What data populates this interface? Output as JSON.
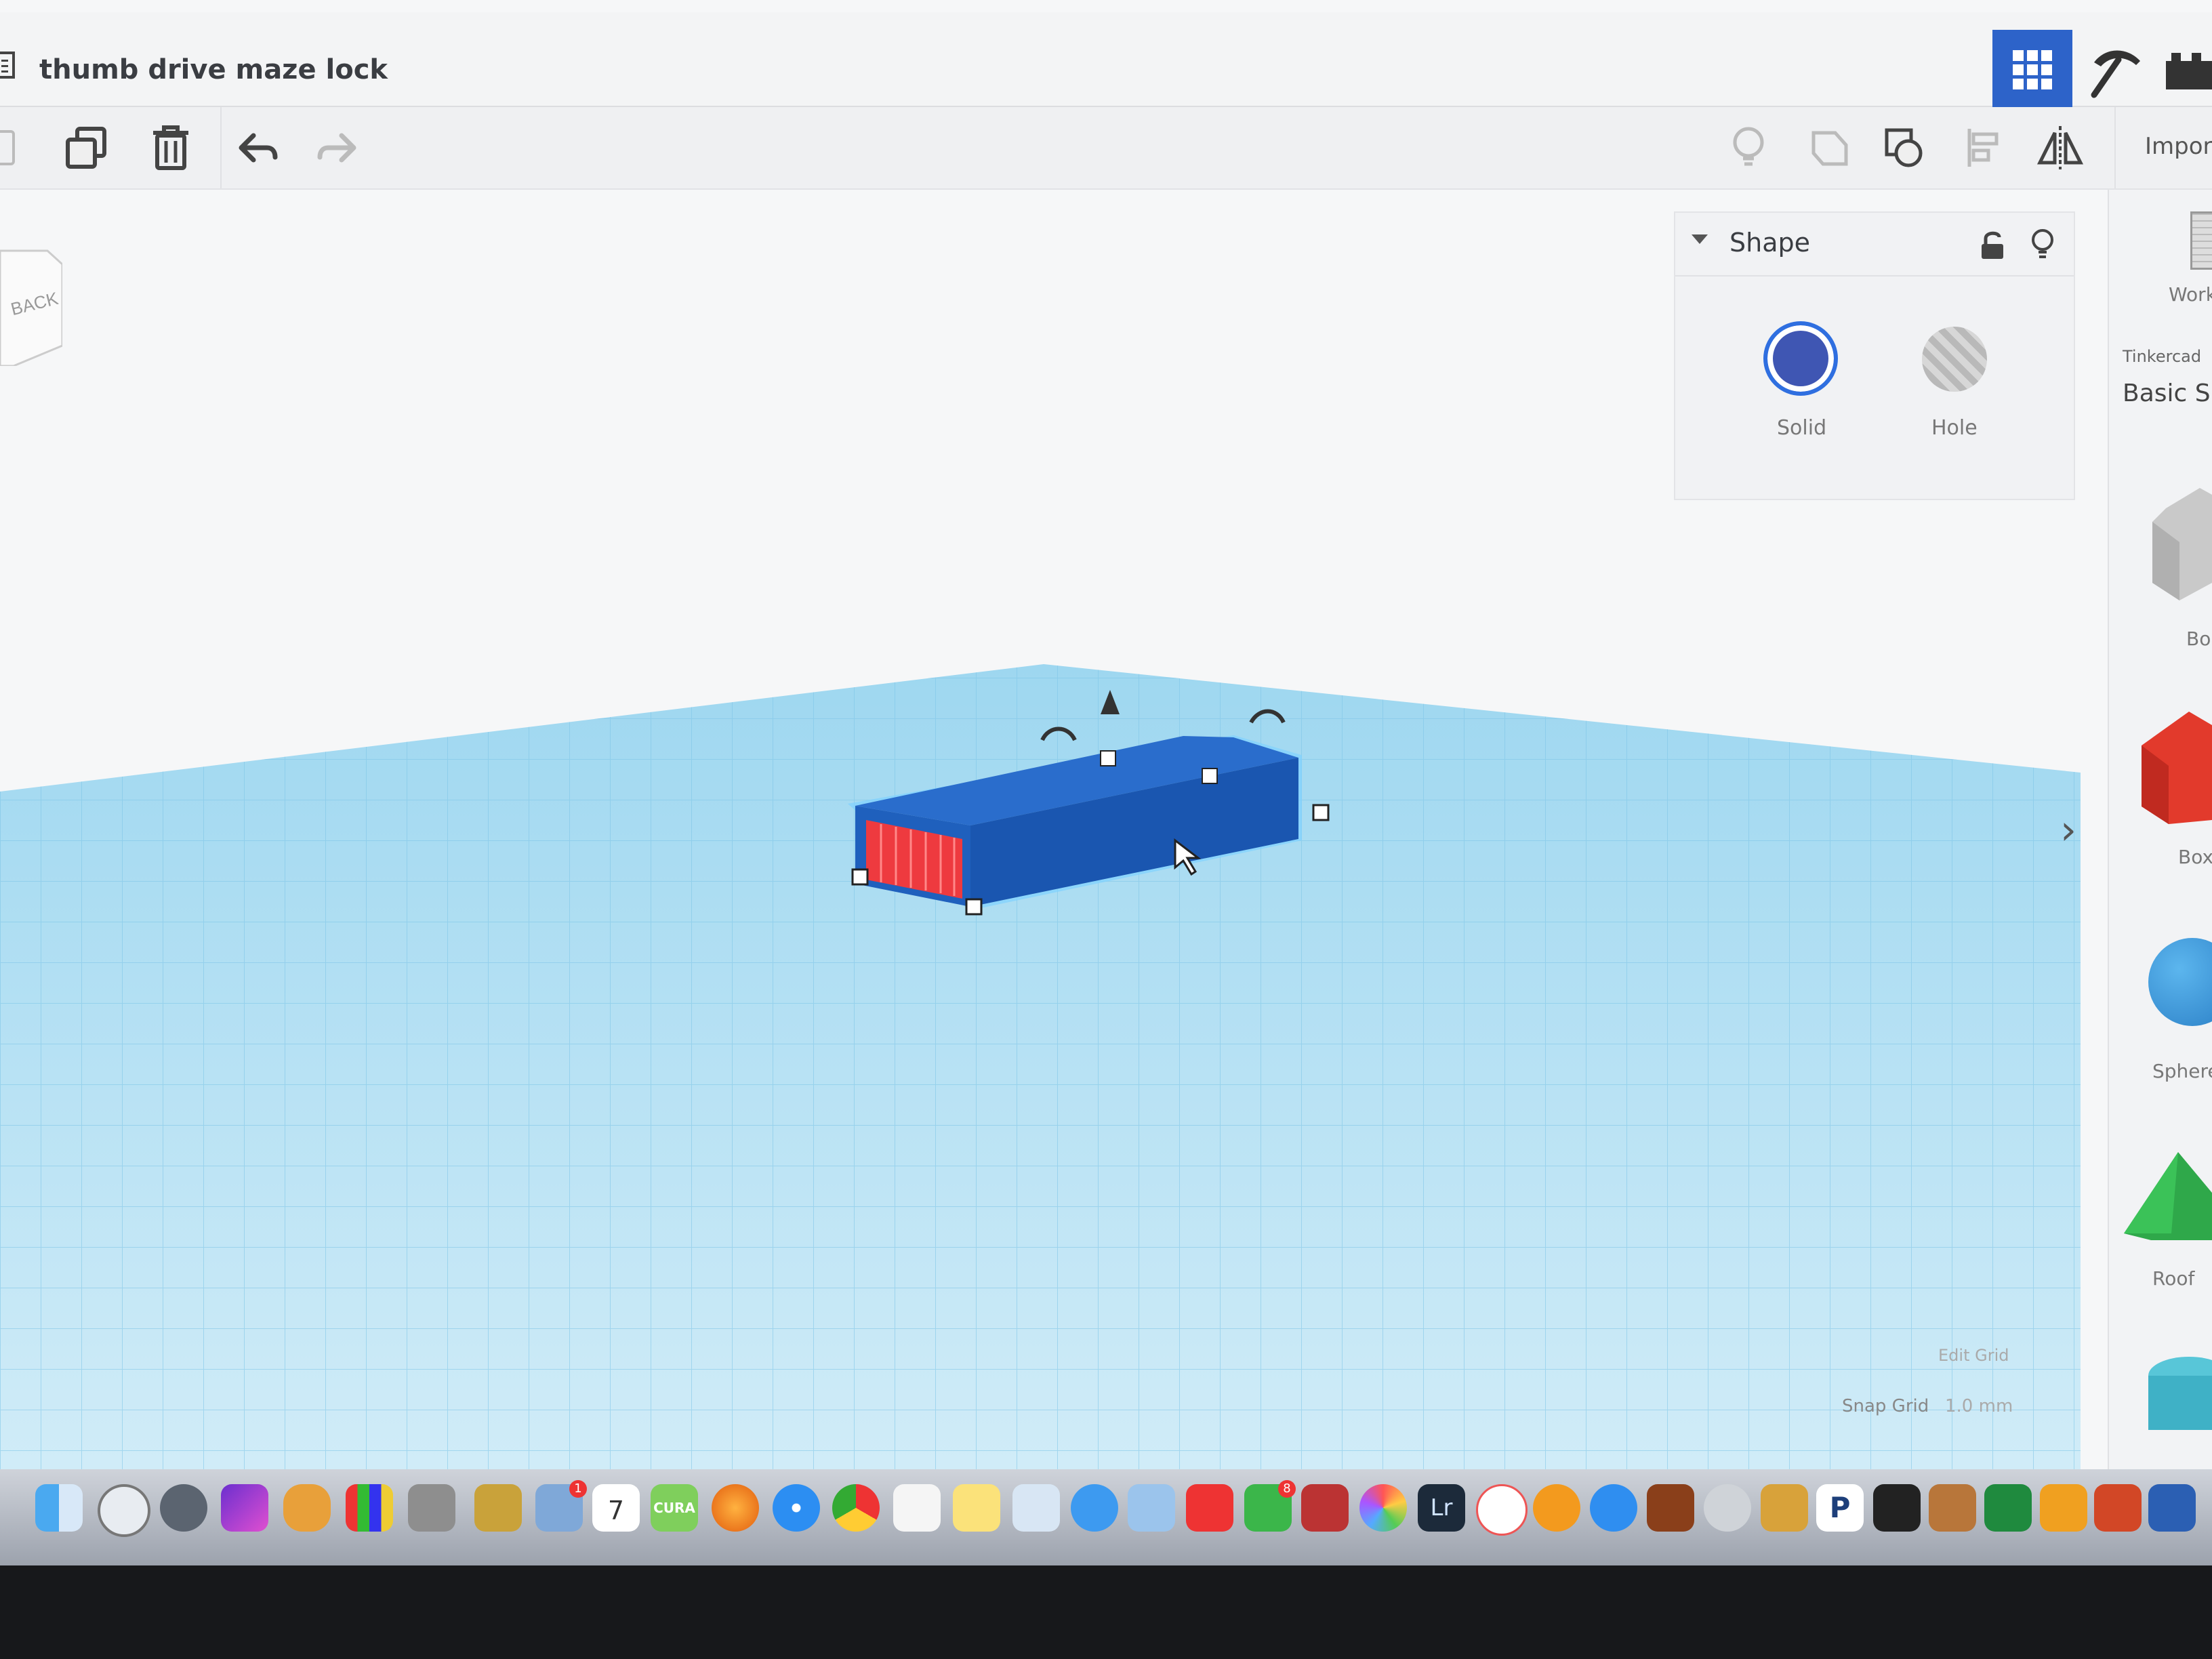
{
  "window": {
    "title": "thumb drive maze lock"
  },
  "toolbar": {
    "import_label": "Impor"
  },
  "viewport": {
    "nav_cube_label": "BACK"
  },
  "inspector": {
    "title": "Shape",
    "solid_label": "Solid",
    "hole_label": "Hole",
    "colors": {
      "solid": "#3f56b3",
      "hole": "#c8c8c8"
    }
  },
  "library": {
    "workplane_label": "Work",
    "source_label": "Tinkercad",
    "category": "Basic Sh",
    "shapes": [
      {
        "label": "Bo",
        "color": "#c8c8c8"
      },
      {
        "label": "Box",
        "color": "#e23a2c"
      },
      {
        "label": "Sphere",
        "color": "#2b8fd6"
      },
      {
        "label": "Roof",
        "color": "#2fa84a"
      }
    ]
  },
  "grid": {
    "edit_label": "Edit Grid",
    "snap_label": "Snap Grid",
    "snap_value": "1.0 mm"
  },
  "dock": {
    "lr_label": "Lr",
    "p_label": "P",
    "calendar_day": "7",
    "cura_label": "CURA",
    "badges": [
      "1",
      "8"
    ]
  },
  "colors": {
    "accent": "#2d63c9",
    "grid": "#8fd0ef",
    "object": "#1f5db8",
    "face": "#ee3a3f"
  }
}
